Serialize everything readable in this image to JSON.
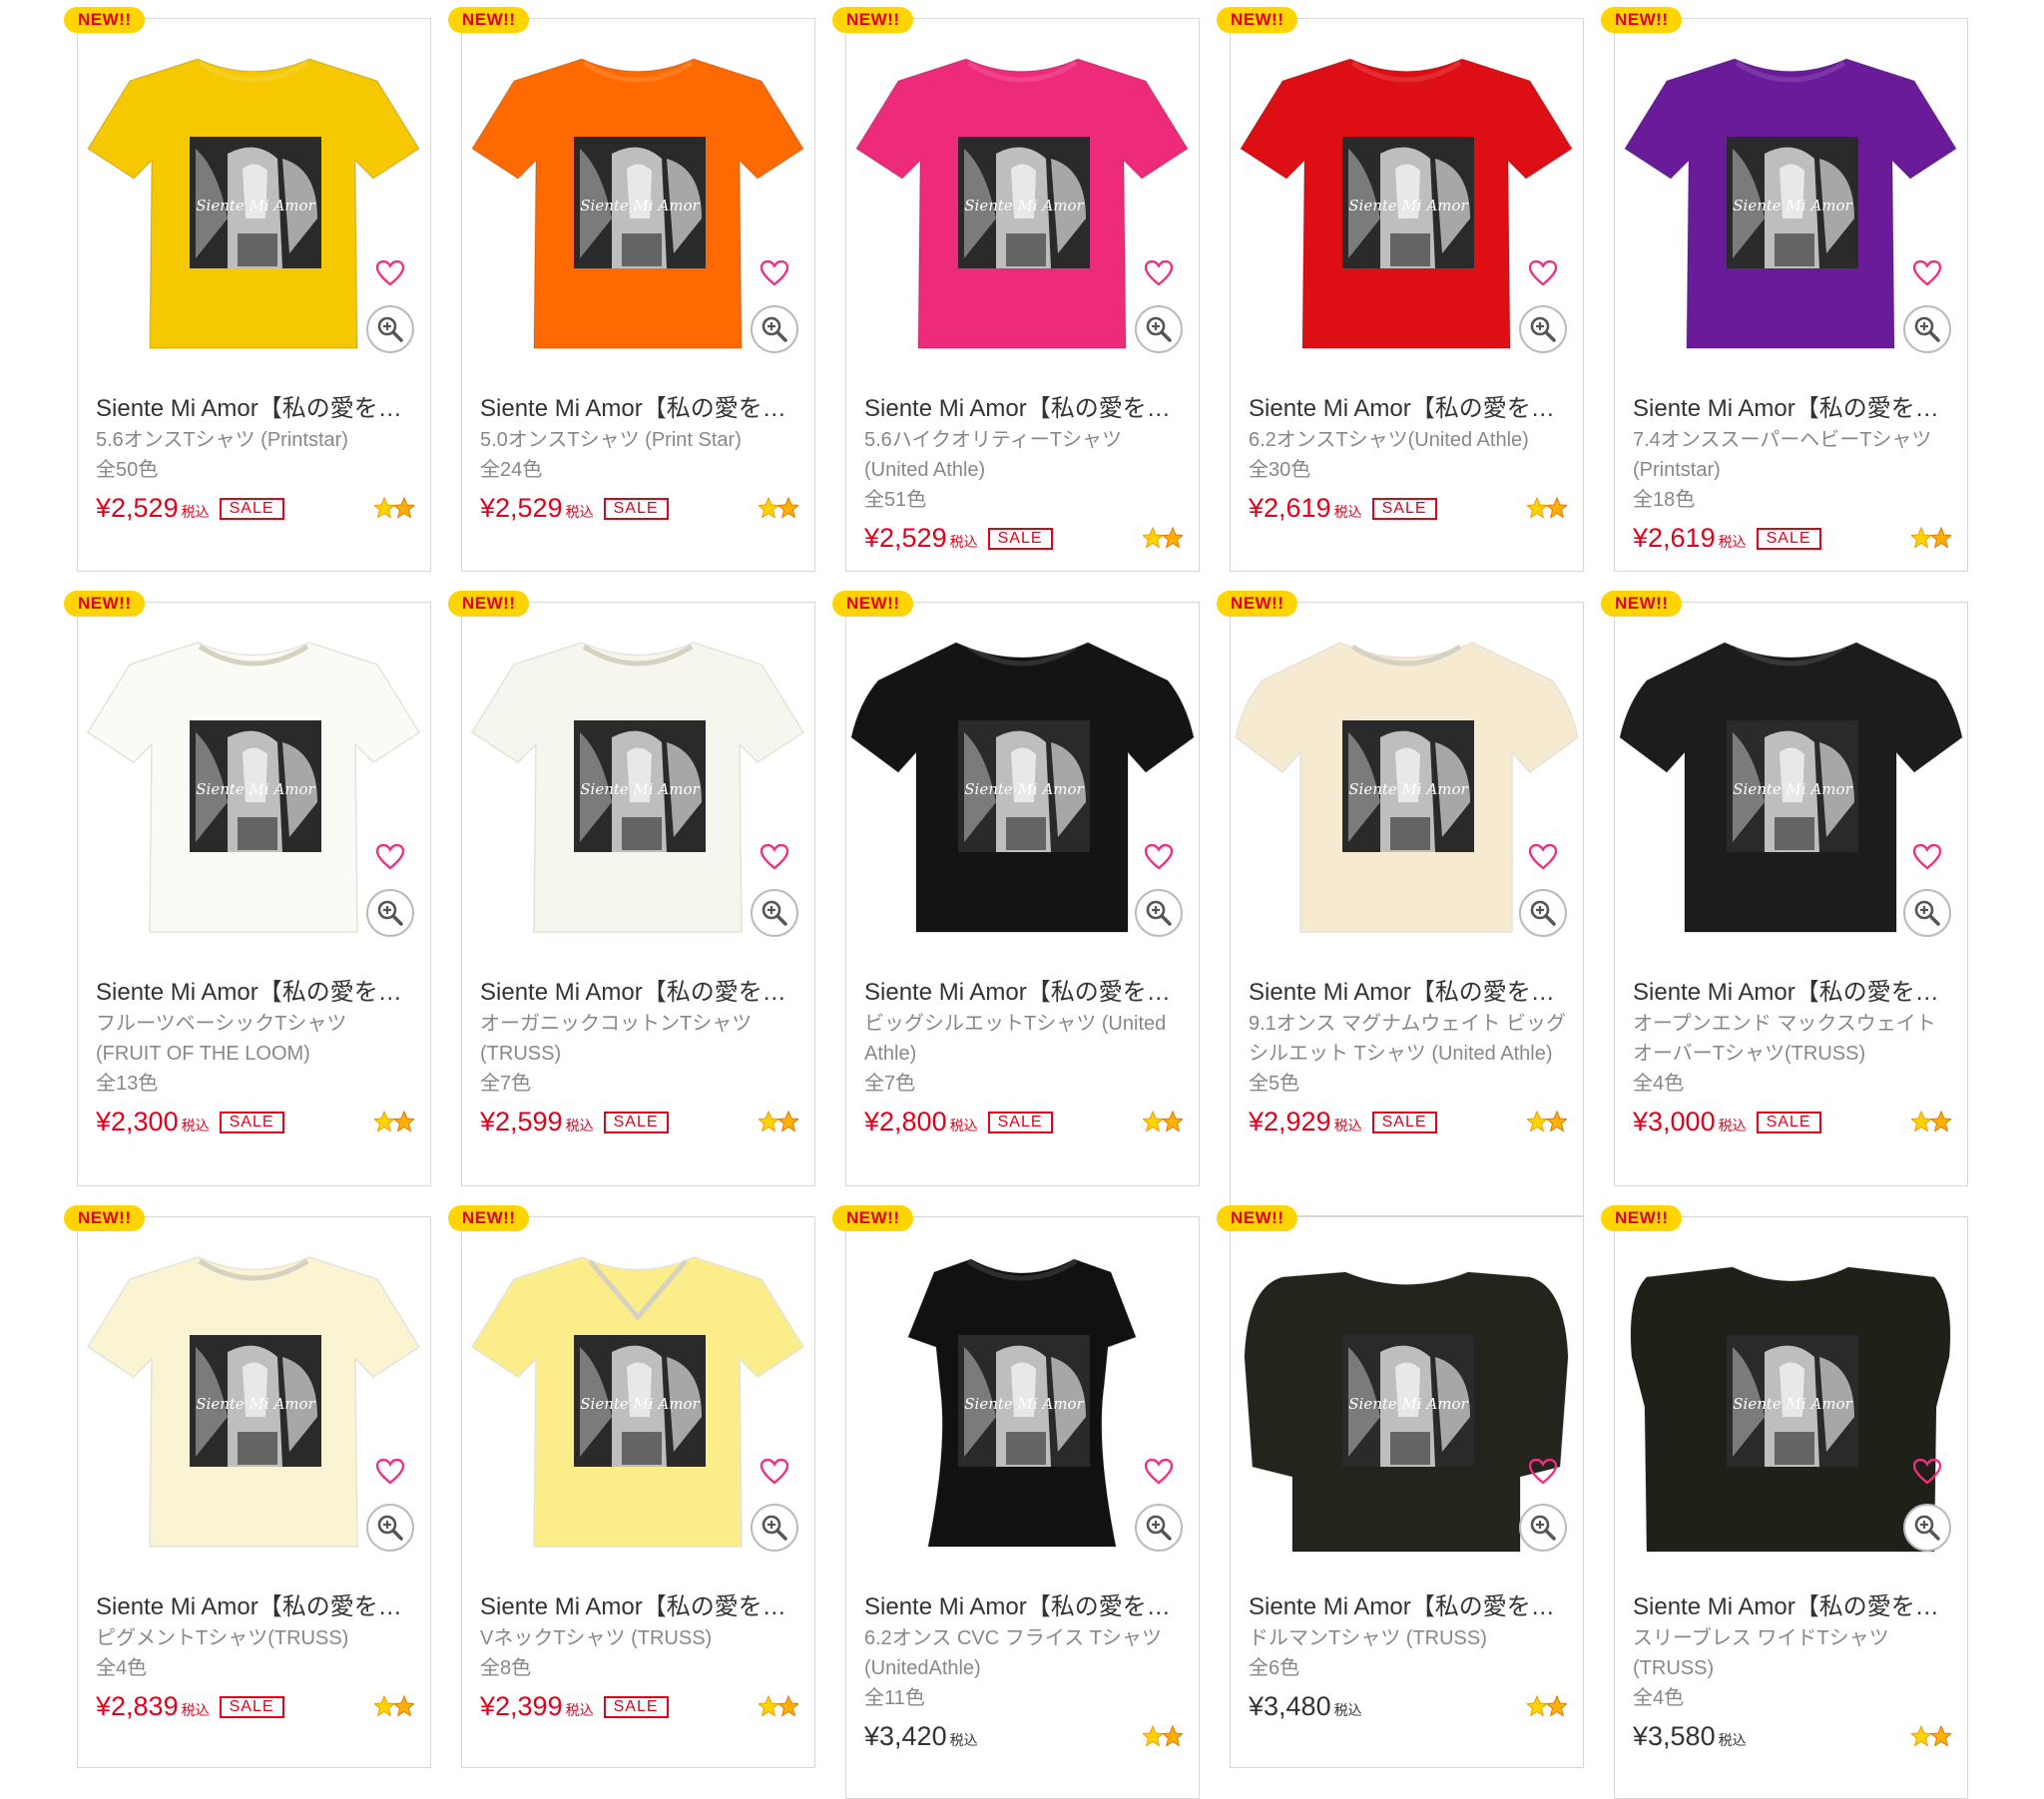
{
  "badge_label": "NEW!!",
  "tax_label": "税込",
  "sale_label": "SALE",
  "products": [
    {
      "title": "Siente Mi Amor【私の愛を感じて】",
      "item": "5.6オンスTシャツ (Printstar)",
      "colors": "全50色",
      "price": "¥2,529",
      "sale": true,
      "shirt_color": "#f6c800",
      "style": "tee"
    },
    {
      "title": "Siente Mi Amor【私の愛を感じて】",
      "item": "5.0オンスTシャツ (Print Star)",
      "colors": "全24色",
      "price": "¥2,529",
      "sale": true,
      "shirt_color": "#ff6a00",
      "style": "tee"
    },
    {
      "title": "Siente Mi Amor【私の愛を感じて】",
      "item": "5.6ハイクオリティーTシャツ (United Athle)",
      "colors": "全51色",
      "price": "¥2,529",
      "sale": true,
      "shirt_color": "#ee2a7b",
      "style": "tee"
    },
    {
      "title": "Siente Mi Amor【私の愛を感じて】",
      "item": "6.2オンスTシャツ(United Athle)",
      "colors": "全30色",
      "price": "¥2,619",
      "sale": true,
      "shirt_color": "#dd0f14",
      "style": "tee"
    },
    {
      "title": "Siente Mi Amor【私の愛を感じて】",
      "item": "7.4オンススーパーヘビーTシャツ (Printstar)",
      "colors": "全18色",
      "price": "¥2,619",
      "sale": true,
      "shirt_color": "#6a1b9a",
      "style": "tee"
    },
    {
      "title": "Siente Mi Amor【私の愛を感じて】",
      "item": "フルーツベーシックTシャツ (FRUIT OF THE LOOM)",
      "colors": "全13色",
      "price": "¥2,300",
      "sale": true,
      "shirt_color": "#fbfbf6",
      "style": "tee"
    },
    {
      "title": "Siente Mi Amor【私の愛を感じて】",
      "item": "オーガニックコットンTシャツ (TRUSS)",
      "colors": "全7色",
      "price": "¥2,599",
      "sale": true,
      "shirt_color": "#f7f6ee",
      "style": "tee"
    },
    {
      "title": "Siente Mi Amor【私の愛を感じて】",
      "item": "ビッグシルエットTシャツ (United Athle)",
      "colors": "全7色",
      "price": "¥2,800",
      "sale": true,
      "shirt_color": "#141414",
      "style": "big"
    },
    {
      "title": "Siente Mi Amor【私の愛を感じて】",
      "item": "9.1オンス マグナムウェイト ビッグシルエット Tシャツ (United Athle)",
      "colors": "全5色",
      "price": "¥2,929",
      "sale": true,
      "shirt_color": "#f6ead0",
      "style": "big"
    },
    {
      "title": "Siente Mi Amor【私の愛を感じて】",
      "item": "オープンエンド マックスウェイト オーバーTシャツ(TRUSS)",
      "colors": "全4色",
      "price": "¥3,000",
      "sale": true,
      "shirt_color": "#1c1c1f",
      "style": "big"
    },
    {
      "title": "Siente Mi Amor【私の愛を感じて】",
      "item": "ピグメントTシャツ(TRUSS)",
      "colors": "全4色",
      "price": "¥2,839",
      "sale": true,
      "shirt_color": "#fbf4d2",
      "style": "tee"
    },
    {
      "title": "Siente Mi Amor【私の愛を感じて】",
      "item": "VネックTシャツ (TRUSS)",
      "colors": "全8色",
      "price": "¥2,399",
      "sale": true,
      "shirt_color": "#fbee8a",
      "style": "tee"
    },
    {
      "title": "Siente Mi Amor【私の愛を感じて】",
      "item": "6.2オンス CVC フライス Tシャツ (UnitedAthle)",
      "colors": "全11色",
      "price": "¥3,420",
      "sale": false,
      "shirt_color": "#111111",
      "style": "ladies"
    },
    {
      "title": "Siente Mi Amor【私の愛を感じて】",
      "item": "ドルマンTシャツ (TRUSS)",
      "colors": "全6色",
      "price": "¥3,480",
      "sale": false,
      "shirt_color": "#23241c",
      "style": "dolman"
    },
    {
      "title": "Siente Mi Amor【私の愛を感じて】",
      "item": "スリーブレス ワイドTシャツ (TRUSS)",
      "colors": "全4色",
      "price": "¥3,580",
      "sale": false,
      "shirt_color": "#1f2119",
      "style": "sleeveless"
    }
  ],
  "icons": {
    "favorite": "heart-outline-icon",
    "zoom": "zoom-in-icon",
    "rating": "two-stars-icon"
  },
  "accent_colors": {
    "badge": "#ffd400",
    "price_sale": "#e3001b",
    "heart": "#ef2f80"
  }
}
